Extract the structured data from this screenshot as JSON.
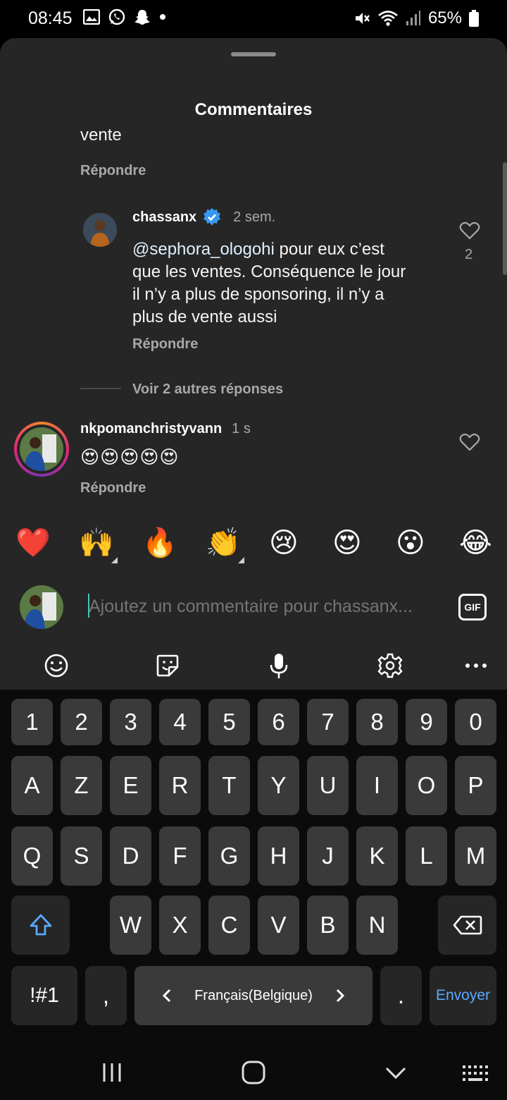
{
  "status_bar": {
    "time": "08:45",
    "battery": "65%",
    "left_icons": [
      "gallery-icon",
      "whatsapp-icon",
      "snapchat-icon",
      "dot-icon"
    ],
    "right_icons": [
      "mute-icon",
      "wifi-icon",
      "signal-icon",
      "battery-icon"
    ]
  },
  "sheet": {
    "title": "Commentaires"
  },
  "comments": {
    "prev_fragment": "vente",
    "prev_reply": "Répondre",
    "reply": {
      "username": "chassanx",
      "time": "2 sem.",
      "mention": "@sephora_ologohi",
      "line1_rest": " pour eux c’est",
      "line2": "que les ventes. Conséquence le jour",
      "line3": "il n’y a plus de sponsoring, il n’y a",
      "line4": "plus de vente aussi",
      "reply_label": "Répondre",
      "likes": "2"
    },
    "more_replies": "Voir 2 autres réponses",
    "comment": {
      "username": "nkpomanchristyvann",
      "time": "1 s",
      "text": "😍😍😍😍😍",
      "reply_label": "Répondre"
    }
  },
  "quick_emojis": [
    "❤️",
    "🙌",
    "🔥",
    "👏",
    "😢",
    "😍",
    "😮",
    "😂"
  ],
  "composer": {
    "placeholder": "Ajoutez un commentaire pour chassanx...",
    "gif_label": "GIF"
  },
  "keyboard_toolbar": [
    "emoji-icon",
    "sticker-icon",
    "microphone-icon",
    "settings-icon",
    "more-icon"
  ],
  "keyboard": {
    "row1": [
      "1",
      "2",
      "3",
      "4",
      "5",
      "6",
      "7",
      "8",
      "9",
      "0"
    ],
    "row2": [
      "A",
      "Z",
      "E",
      "R",
      "T",
      "Y",
      "U",
      "I",
      "O",
      "P"
    ],
    "row3": [
      "Q",
      "S",
      "D",
      "F",
      "G",
      "H",
      "J",
      "K",
      "L",
      "M"
    ],
    "row4": [
      "W",
      "X",
      "C",
      "V",
      "B",
      "N"
    ],
    "symbols": "!#1",
    "comma": ",",
    "space_label": "Français(Belgique)",
    "period": ".",
    "send": "Envoyer"
  },
  "colors": {
    "sheet_bg": "#262626",
    "text_muted": "#a8a8a8",
    "verified": "#3897f0",
    "key_bg": "#3a3a3a",
    "send_blue": "#5aa8ff"
  }
}
